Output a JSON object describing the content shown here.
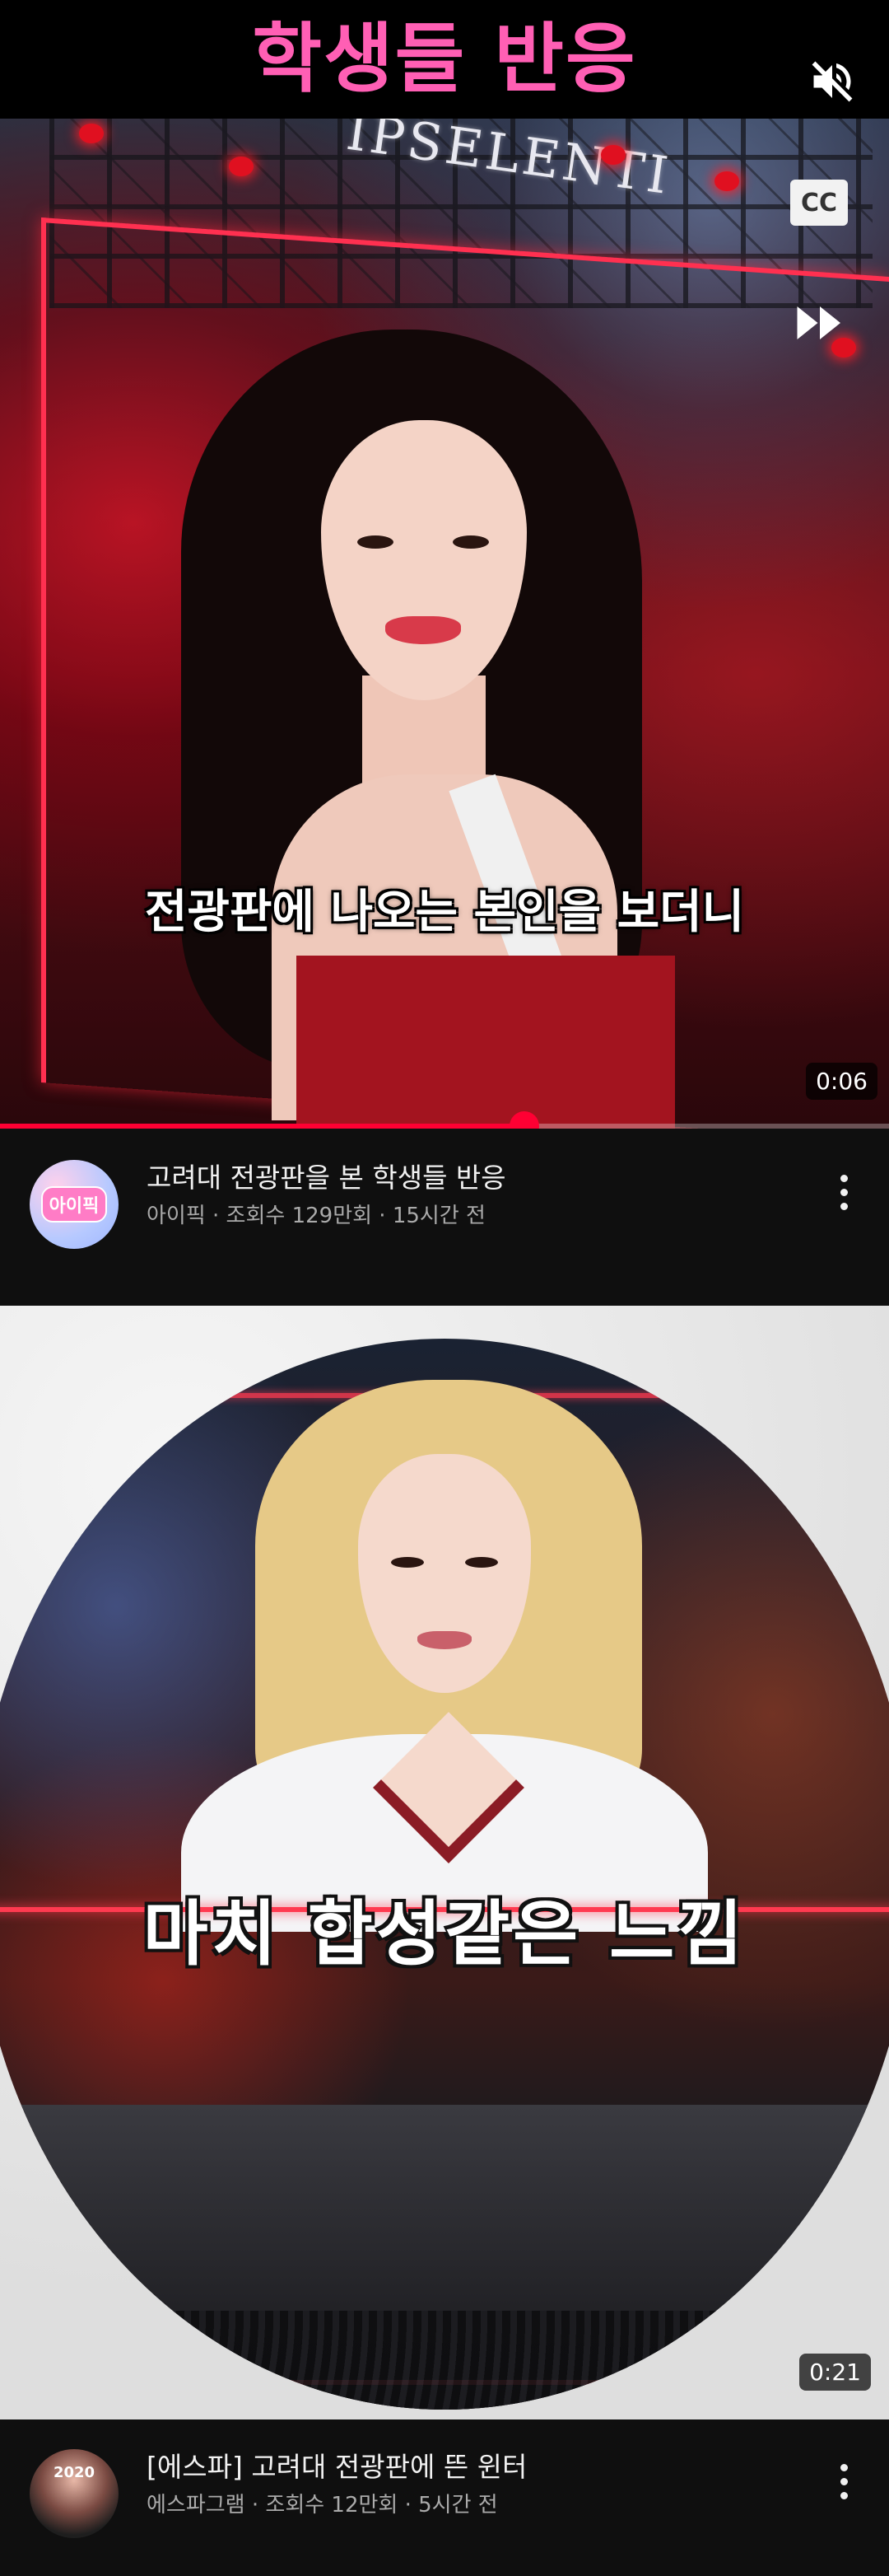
{
  "player": {
    "header_title": "학생들 반응",
    "sign_text": "IPSELENTI",
    "cc_label": "CC",
    "subtitle": "전광판에 나오는 본인을 보더니",
    "time": "0:06",
    "progress_fraction": 0.59,
    "icons": [
      "volume-off-icon",
      "closed-captions-icon",
      "fast-forward-icon"
    ],
    "colors": {
      "header_text": "#ff5fb4",
      "progress": "#ff0033"
    }
  },
  "videos": [
    {
      "channel_avatar_text": "아이픽",
      "title": "고려대 전광판을 본 학생들 반응",
      "meta": "아이픽 · 조회수 129만회 · 15시간 전"
    },
    {
      "thumbnail_caption": "마치 합성같은 느낌",
      "duration": "0:21",
      "title": "[에스파] 고려대 전광판에 뜬 윈터",
      "meta": "에스파그램 · 조회수 12만회 · 5시간 전"
    }
  ]
}
